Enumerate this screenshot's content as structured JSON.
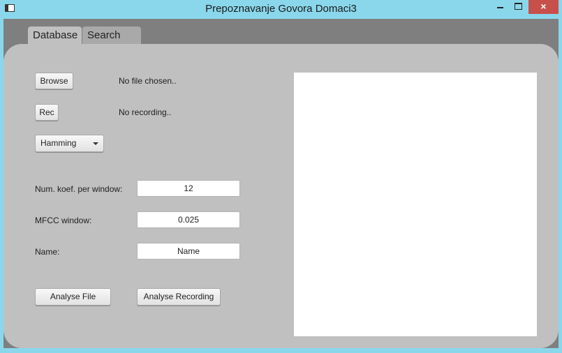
{
  "window": {
    "title": "Prepoznavanje Govora Domaci3",
    "close_label": "×"
  },
  "tabs": [
    {
      "label": "Database",
      "selected": true
    },
    {
      "label": "Search",
      "selected": false
    }
  ],
  "database": {
    "browse_label": "Browse",
    "file_status": "No file chosen..",
    "rec_label": "Rec",
    "recording_status": "No recording..",
    "window_type": {
      "selected": "Hamming",
      "icon": "chevron-down-icon"
    },
    "num_koef": {
      "label": "Num. koef. per window:",
      "value": "12"
    },
    "mfcc_window": {
      "label": "MFCC window:",
      "value": "0.025"
    },
    "name": {
      "label": "Name:",
      "value": "Name"
    },
    "analyse_file_label": "Analyse File",
    "analyse_recording_label": "Analyse Recording"
  },
  "colors": {
    "titlebar": "#8ad7ec",
    "panel": "#c0c0c0",
    "client_bg": "#7f7f7f",
    "close_button": "#c7504b"
  }
}
